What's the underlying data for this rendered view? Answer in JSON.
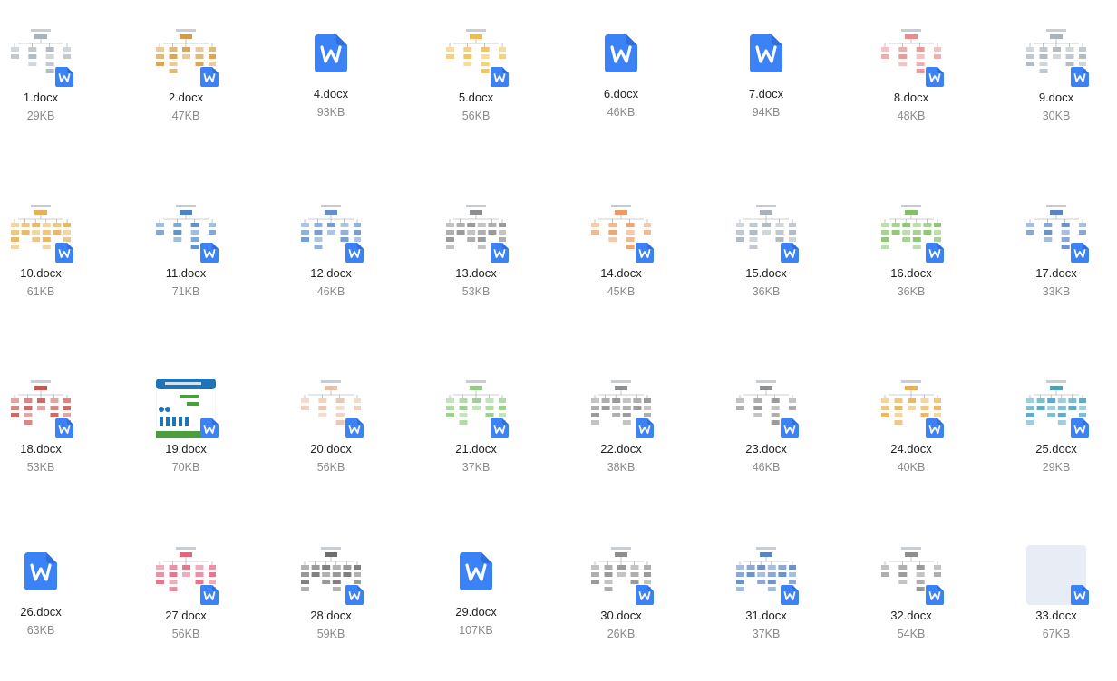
{
  "files": [
    {
      "name": "1.docx",
      "size": "29KB",
      "thumb": "diagram",
      "accent": "#9aa4b0"
    },
    {
      "name": "2.docx",
      "size": "47KB",
      "thumb": "diagram",
      "accent": "#c98a2e"
    },
    {
      "name": "4.docx",
      "size": "93KB",
      "thumb": "icon",
      "accent": "#3b82f6"
    },
    {
      "name": "5.docx",
      "size": "56KB",
      "thumb": "diagram",
      "accent": "#e8b23a"
    },
    {
      "name": "6.docx",
      "size": "46KB",
      "thumb": "icon",
      "accent": "#3b82f6"
    },
    {
      "name": "7.docx",
      "size": "94KB",
      "thumb": "icon",
      "accent": "#3b82f6"
    },
    {
      "name": "8.docx",
      "size": "48KB",
      "thumb": "diagram",
      "accent": "#e07a7a"
    },
    {
      "name": "9.docx",
      "size": "30KB",
      "thumb": "diagram",
      "accent": "#9aa4b0"
    },
    {
      "name": "10.docx",
      "size": "61KB",
      "thumb": "diagram",
      "accent": "#e0a23a"
    },
    {
      "name": "11.docx",
      "size": "71KB",
      "thumb": "diagram",
      "accent": "#2f6fb6"
    },
    {
      "name": "12.docx",
      "size": "46KB",
      "thumb": "diagram",
      "accent": "#4a7cc4"
    },
    {
      "name": "13.docx",
      "size": "53KB",
      "thumb": "diagram",
      "accent": "#7a7a7a"
    },
    {
      "name": "14.docx",
      "size": "45KB",
      "thumb": "diagram",
      "accent": "#e58a4b"
    },
    {
      "name": "15.docx",
      "size": "36KB",
      "thumb": "diagram",
      "accent": "#9aa4b0"
    },
    {
      "name": "16.docx",
      "size": "36KB",
      "thumb": "diagram",
      "accent": "#6db34f"
    },
    {
      "name": "17.docx",
      "size": "33KB",
      "thumb": "diagram",
      "accent": "#3f6db7"
    },
    {
      "name": "18.docx",
      "size": "53KB",
      "thumb": "diagram",
      "accent": "#b83a34"
    },
    {
      "name": "19.docx",
      "size": "70KB",
      "thumb": "banner",
      "accent": "#1f73b7"
    },
    {
      "name": "20.docx",
      "size": "56KB",
      "thumb": "diagram",
      "accent": "#e2b59a"
    },
    {
      "name": "21.docx",
      "size": "37KB",
      "thumb": "diagram",
      "accent": "#7fbf6e"
    },
    {
      "name": "22.docx",
      "size": "38KB",
      "thumb": "diagram",
      "accent": "#7a7a7a"
    },
    {
      "name": "23.docx",
      "size": "46KB",
      "thumb": "diagram",
      "accent": "#7a7a7a"
    },
    {
      "name": "24.docx",
      "size": "40KB",
      "thumb": "diagram",
      "accent": "#e0a23a"
    },
    {
      "name": "25.docx",
      "size": "29KB",
      "thumb": "diagram",
      "accent": "#2f8fb0"
    },
    {
      "name": "26.docx",
      "size": "63KB",
      "thumb": "icon",
      "accent": "#3b82f6"
    },
    {
      "name": "27.docx",
      "size": "56KB",
      "thumb": "diagram",
      "accent": "#d94a6a"
    },
    {
      "name": "28.docx",
      "size": "59KB",
      "thumb": "diagram",
      "accent": "#555555"
    },
    {
      "name": "29.docx",
      "size": "107KB",
      "thumb": "icon",
      "accent": "#3b82f6"
    },
    {
      "name": "30.docx",
      "size": "26KB",
      "thumb": "diagram",
      "accent": "#7a7a7a"
    },
    {
      "name": "31.docx",
      "size": "37KB",
      "thumb": "diagram",
      "accent": "#3f6db7"
    },
    {
      "name": "32.docx",
      "size": "54KB",
      "thumb": "diagram",
      "accent": "#7a7a7a"
    },
    {
      "name": "33.docx",
      "size": "67KB",
      "thumb": "blank",
      "accent": "#e8ecf5"
    }
  ],
  "colors": {
    "fileBlue": "#3b82f6",
    "fileBlueDark": "#2f6fdd"
  }
}
